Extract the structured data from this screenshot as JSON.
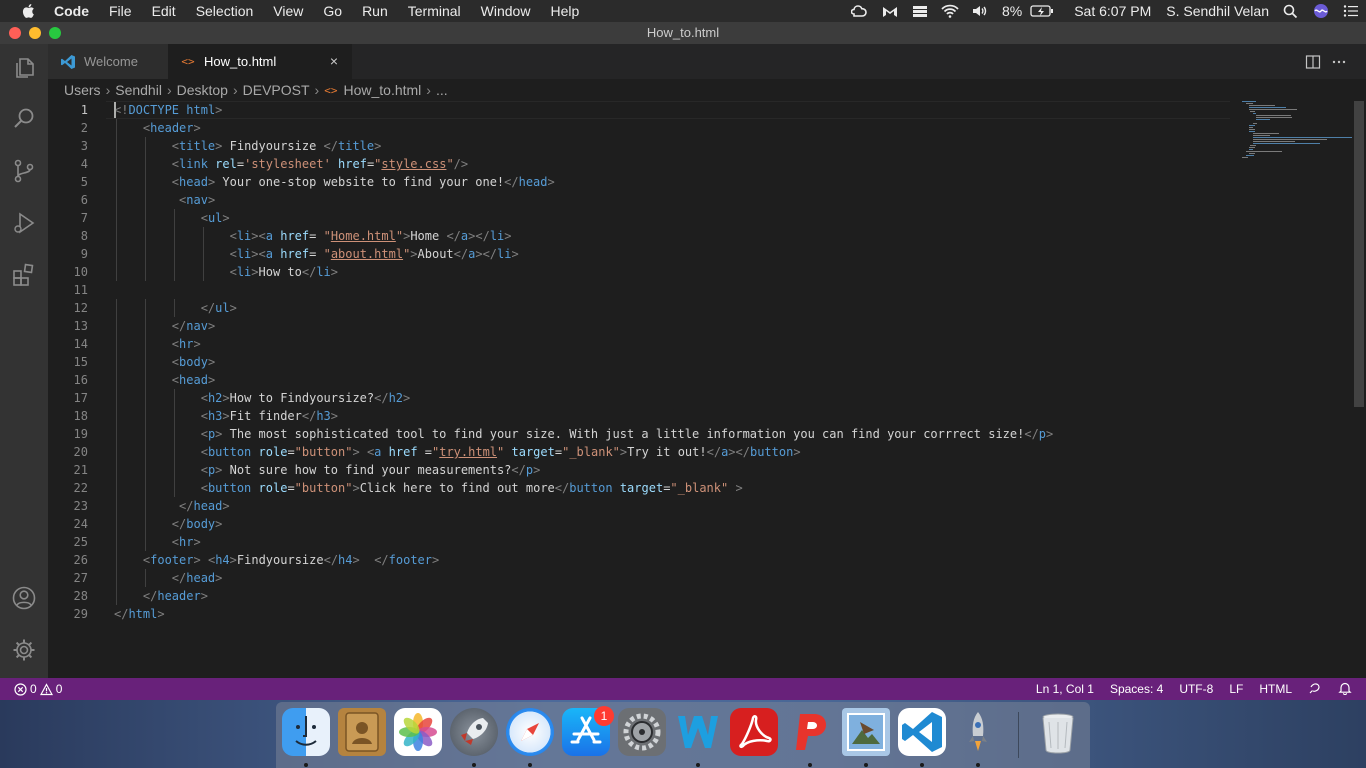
{
  "menubar": {
    "items": [
      "Code",
      "File",
      "Edit",
      "Selection",
      "View",
      "Go",
      "Run",
      "Terminal",
      "Window",
      "Help"
    ],
    "battery": "8%",
    "clock": "Sat 6:07 PM",
    "user": "S. Sendhil Velan"
  },
  "window": {
    "title": "How_to.html"
  },
  "tabs": [
    {
      "label": "Welcome",
      "icon": "vscode-icon"
    },
    {
      "label": "How_to.html",
      "icon": "html-file-icon",
      "close": "×"
    }
  ],
  "breadcrumb": [
    "Users",
    "Sendhil",
    "Desktop",
    "DEVPOST",
    "How_to.html",
    "..."
  ],
  "editor": {
    "current_line": 1,
    "line_numbers": [
      "1",
      "2",
      "3",
      "4",
      "5",
      "6",
      "7",
      "8",
      "9",
      "10",
      "11",
      "12",
      "13",
      "14",
      "15",
      "16",
      "17",
      "18",
      "19",
      "20",
      "21",
      "22",
      "23",
      "24",
      "25",
      "26",
      "27",
      "28",
      "29"
    ],
    "lines": [
      "<!DOCTYPE html>",
      "    <header>",
      "        <title> Findyoursize </title>",
      "        <link rel='stylesheet' href=\"style.css\"/>",
      "        <head> Your one-stop website to find your one!</head>",
      "         <nav>",
      "            <ul>",
      "                <li><a href= \"Home.html\">Home </a></li>",
      "                <li><a href= \"about.html\">About</a></li>",
      "                <li>How to</li>",
      "",
      "            </ul>",
      "        </nav>",
      "        <hr>",
      "        <body>",
      "        <head>",
      "            <h2>How to Findyoursize?</h2>",
      "            <h3>Fit finder</h3>",
      "            <p> The most sophisticated tool to find your size. With just a little information you can find your corrrect size!</p>",
      "            <button role=\"button\"> <a href =\"try.html\" target=\"_blank\">Try it out!</a></button>",
      "            <p> Not sure how to find your measurements?</p>",
      "            <button role=\"button\">Click here to find out more</button target=\"_blank\" >",
      "         </head>",
      "        </body>",
      "        <hr>",
      "    <footer> <h4>Findyoursize</h4>  </footer>",
      "        </head>",
      "    </header>",
      "</html>"
    ]
  },
  "statusbar": {
    "errors": "0",
    "warnings": "0",
    "position": "Ln 1, Col 1",
    "spaces": "Spaces: 4",
    "encoding": "UTF-8",
    "eol": "LF",
    "language": "HTML"
  },
  "dock": {
    "apps": [
      "finder-icon",
      "contacts-icon",
      "photos-icon",
      "launchpad-icon",
      "safari-icon",
      "app-store-icon",
      "system-preferences-icon",
      "word-icon",
      "acrobat-icon",
      "wps-presentation-icon",
      "preview-icon",
      "vscode-icon",
      "rocket-icon",
      "trash-icon"
    ],
    "app_store_badge": "1"
  },
  "colors": {
    "statusbar": "#68217a",
    "tag": "#569cd6",
    "attribute": "#9cdcfe",
    "string": "#ce9178",
    "bracket": "#808080"
  }
}
